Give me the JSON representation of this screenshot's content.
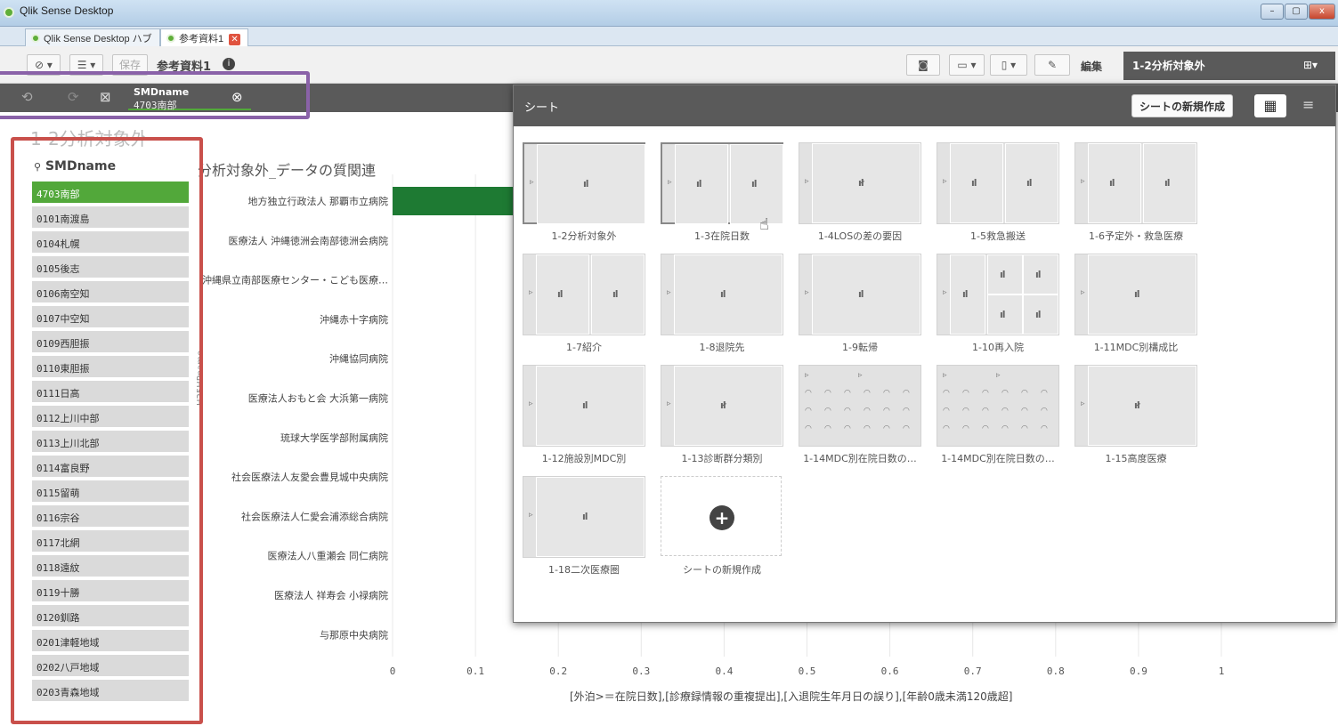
{
  "window": {
    "title": "Qlik Sense Desktop",
    "min": "–",
    "max": "▢",
    "close": "x"
  },
  "tabs": [
    {
      "label": "Qlik Sense Desktop ハブ"
    },
    {
      "label": "参考資料1"
    }
  ],
  "toolbar": {
    "save": "保存",
    "app_title": "参考資料1",
    "info": "i",
    "edit": "編集",
    "current_sheet": "1-2分析対象外"
  },
  "selections": {
    "field": "SMDname",
    "value": "4703南部"
  },
  "page": {
    "sheet_title": "1-2分析対象外",
    "chart_title": "分析対象外_データの質関連",
    "y_axis_label": "H25HPname",
    "x_axis_label": "[外泊>＝在院日数],[診療録情報の重複提出],[入退院生年月日の誤り],[年齢0歳未満120歳超]"
  },
  "listbox": {
    "title": "SMDname",
    "items": [
      "4703南部",
      "0101南渡島",
      "0104札幌",
      "0105後志",
      "0106南空知",
      "0107中空知",
      "0109西胆振",
      "0110東胆振",
      "0111日高",
      "0112上川中部",
      "0113上川北部",
      "0114富良野",
      "0115留萌",
      "0116宗谷",
      "0117北網",
      "0118遠紋",
      "0119十勝",
      "0120釧路",
      "0201津軽地域",
      "0202八戸地域",
      "0203青森地域"
    ]
  },
  "chart_data": {
    "type": "bar",
    "orientation": "horizontal",
    "categories": [
      "地方独立行政法人 那覇市立病院",
      "医療法人 沖縄徳洲会南部徳洲会病院",
      "沖縄県立南部医療センター・こども医療…",
      "沖縄赤十字病院",
      "沖縄協同病院",
      "医療法人おもと会 大浜第一病院",
      "琉球大学医学部附属病院",
      "社会医療法人友愛会豊見城中央病院",
      "社会医療法人仁愛会浦添総合病院",
      "医療法人八重瀬会 同仁病院",
      "医療法人 祥寿会 小禄病院",
      "与那原中央病院"
    ],
    "xlabel": "[外泊>＝在院日数],[診療録情報の重複提出],[入退院生年月日の誤り],[年齢0歳未満120歳超]",
    "ylabel": "H25HPname",
    "xlim": [
      0,
      1
    ],
    "xticks": [
      "0",
      "0.1",
      "0.2",
      "0.3",
      "0.4",
      "0.5",
      "0.6",
      "0.7",
      "0.8",
      "0.9",
      "1"
    ]
  },
  "sheet_panel": {
    "title": "シート",
    "new_button": "シートの新規作成",
    "sheets": [
      "1-2分析対象外",
      "1-3在院日数",
      "1-4LOSの差の要因",
      "1-5救急搬送",
      "1-6予定外・救急医療",
      "1-7紹介",
      "1-8退院先",
      "1-9転帰",
      "1-10再入院",
      "1-11MDC別構成比",
      "1-12施設別MDC別",
      "1-13診断群分類別",
      "1-14MDC別在院日数の…",
      "1-14MDC別在院日数の…",
      "1-15高度医療",
      "1-18二次医療圏"
    ],
    "new_sheet_label": "シートの新規作成"
  },
  "colors": {
    "accent": "#52a83a",
    "bar": "#1e7a33",
    "panel_header": "#5a5a5a",
    "annotation_red": "#c9504b",
    "annotation_purple": "#8a62a8"
  }
}
